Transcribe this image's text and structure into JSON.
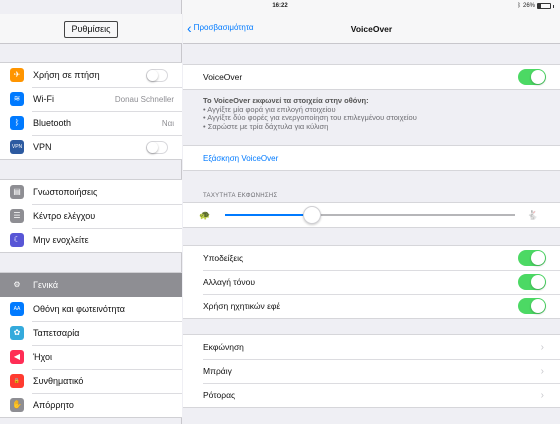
{
  "status": {
    "device": "iPad",
    "time": "16:22",
    "battery": "26%"
  },
  "sidebar": {
    "title": "Ρυθμίσεις",
    "group1": [
      {
        "label": "Χρήση σε πτήση",
        "icon": "airplane-icon",
        "color": "#ff9500",
        "glyph": "✈",
        "toggle": true
      },
      {
        "label": "Wi-Fi",
        "icon": "wifi-icon",
        "color": "#007aff",
        "glyph": "≋",
        "value": "Donau Schneller"
      },
      {
        "label": "Bluetooth",
        "icon": "bluetooth-icon",
        "color": "#007aff",
        "glyph": "ᛒ",
        "value": "Ναι"
      },
      {
        "label": "VPN",
        "icon": "vpn-icon",
        "color": "#2c5aa0",
        "glyph": "VPN",
        "toggle": true
      }
    ],
    "group2": [
      {
        "label": "Γνωστοποιήσεις",
        "icon": "notifications-icon",
        "color": "#8e8e93",
        "glyph": "▤"
      },
      {
        "label": "Κέντρο ελέγχου",
        "icon": "control-center-icon",
        "color": "#8e8e93",
        "glyph": "☰"
      },
      {
        "label": "Μην ενοχλείτε",
        "icon": "moon-icon",
        "color": "#5856d6",
        "glyph": "☾"
      }
    ],
    "group3": [
      {
        "label": "Γενικά",
        "icon": "gear-icon",
        "color": "#8e8e93",
        "glyph": "⚙",
        "selected": true
      },
      {
        "label": "Οθόνη και φωτεινότητα",
        "icon": "display-icon",
        "color": "#007aff",
        "glyph": "AA"
      },
      {
        "label": "Ταπετσαρία",
        "icon": "wallpaper-icon",
        "color": "#34aadc",
        "glyph": "✿"
      },
      {
        "label": "Ήχοι",
        "icon": "sounds-icon",
        "color": "#ff2d55",
        "glyph": "◀"
      },
      {
        "label": "Συνθηματικό",
        "icon": "passcode-icon",
        "color": "#ff3b30",
        "glyph": "🔒"
      },
      {
        "label": "Απόρρητο",
        "icon": "privacy-icon",
        "color": "#8e8e93",
        "glyph": "✋"
      }
    ]
  },
  "nav": {
    "back": "Προσβασιμότητα",
    "title": "VoiceOver"
  },
  "voiceover": {
    "label": "VoiceOver",
    "desc_head": "Το VoiceOver εκφωνεί τα στοιχεία στην οθόνη:",
    "desc_lines": [
      "• Αγγίξτε μία φορά για επιλογή στοιχείου",
      "• Αγγίξτε δύο φορές για ενεργοποίηση του επιλεγμένου στοιχείου",
      "• Σαρώστε με τρία δάχτυλα για κύλιση"
    ],
    "practice": "Εξάσκηση VoiceOver",
    "rate_caption": "ΤΑΧΥΤΗΤΑ ΕΚΦΩΝΗΣΗΣ",
    "rate_fraction": 0.3,
    "toggles": [
      {
        "label": "Υποδείξεις",
        "on": true
      },
      {
        "label": "Αλλαγή τόνου",
        "on": true
      },
      {
        "label": "Χρήση ηχητικών εφέ",
        "on": true
      }
    ],
    "links": [
      "Εκφώνηση",
      "Μπράιγ",
      "Ρότορας"
    ]
  }
}
